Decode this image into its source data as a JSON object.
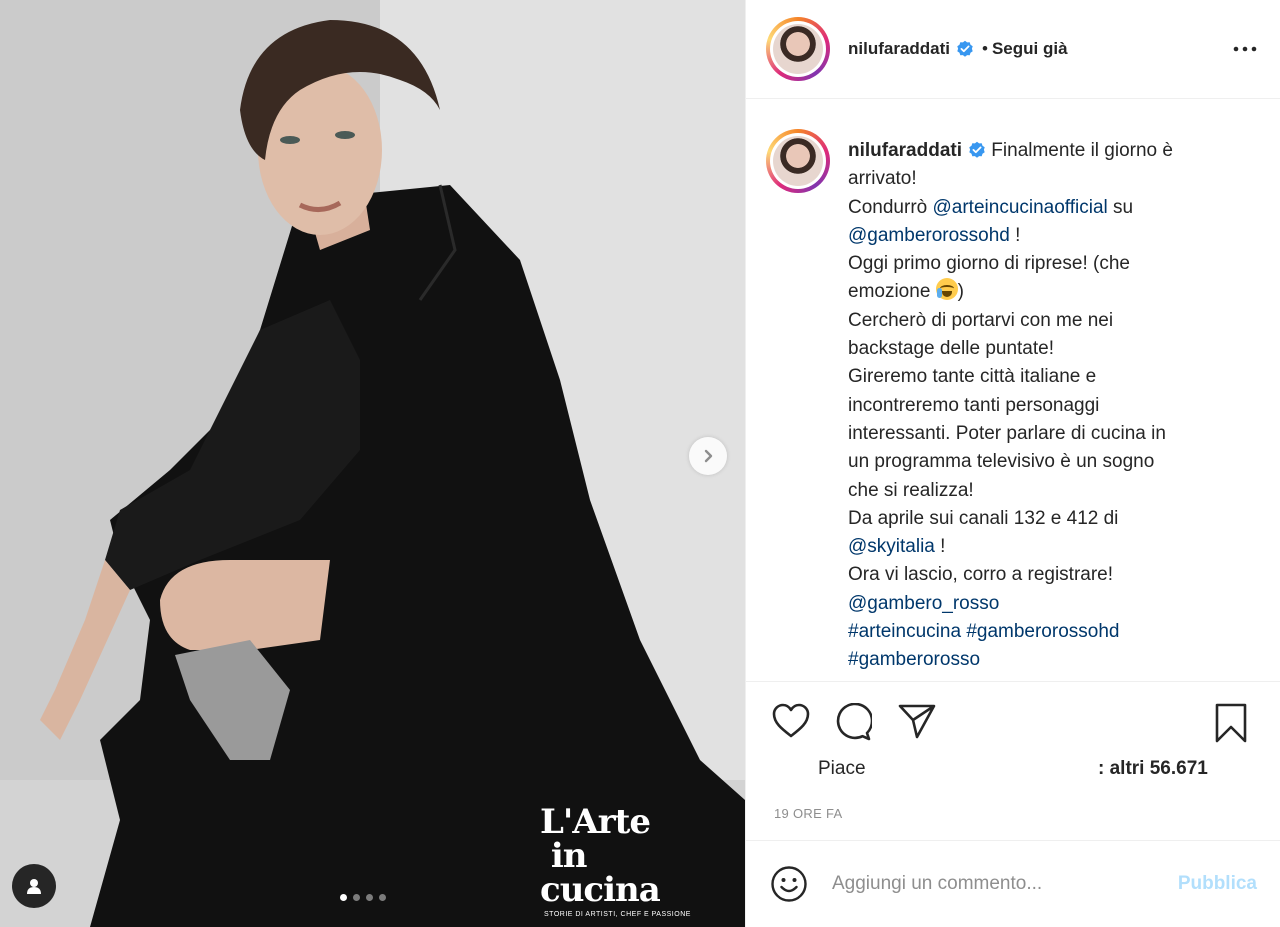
{
  "post": {
    "username": "nilufaraddati",
    "follow_separator": "•",
    "follow_label": "Segui già"
  },
  "media": {
    "watermark_title": "L'Arte in cucina",
    "watermark_subtitle": "STORIE DI ARTISTI, CHEF E PASSIONE",
    "slide_count": 4,
    "active_slide": 1
  },
  "caption": {
    "username": "nilufaraddati",
    "lines": [
      {
        "segments": [
          {
            "text": "Finalmente il giorno è"
          }
        ]
      },
      {
        "segments": [
          {
            "text": "arrivato!"
          }
        ]
      },
      {
        "segments": [
          {
            "text": "Condurrò "
          },
          {
            "text": "@arteincucinaofficial",
            "link": true
          },
          {
            "text": " su"
          }
        ]
      },
      {
        "segments": [
          {
            "text": "@gamberorossohd",
            "link": true
          },
          {
            "text": " !"
          }
        ]
      },
      {
        "segments": [
          {
            "text": "Oggi primo giorno di riprese! (che"
          }
        ]
      },
      {
        "segments": [
          {
            "text": "emozione "
          },
          {
            "emoji": "crying-face"
          },
          {
            "text": ")"
          }
        ]
      },
      {
        "segments": [
          {
            "text": "Cercherò di portarvi con me nei"
          }
        ]
      },
      {
        "segments": [
          {
            "text": "backstage delle puntate!"
          }
        ]
      },
      {
        "segments": [
          {
            "text": "Gireremo tante città italiane e"
          }
        ]
      },
      {
        "segments": [
          {
            "text": "incontreremo tanti personaggi"
          }
        ]
      },
      {
        "segments": [
          {
            "text": "interessanti. Poter parlare di cucina in"
          }
        ]
      },
      {
        "segments": [
          {
            "text": "un programma televisivo è un sogno"
          }
        ]
      },
      {
        "segments": [
          {
            "text": "che si realizza!"
          }
        ]
      },
      {
        "segments": [
          {
            "text": "Da aprile sui canali 132 e 412 di"
          }
        ]
      },
      {
        "segments": [
          {
            "text": "@skyitalia",
            "link": true
          },
          {
            "text": " !"
          }
        ]
      },
      {
        "segments": [
          {
            "text": "Ora vi lascio, corro a registrare!"
          }
        ]
      },
      {
        "segments": [
          {
            "text": "@gambero_rosso",
            "link": true
          }
        ]
      },
      {
        "segments": [
          {
            "text": "#arteincucina",
            "link": true
          },
          {
            "text": " "
          },
          {
            "text": "#gamberorossohd",
            "link": true
          }
        ]
      },
      {
        "segments": [
          {
            "text": "#gamberorosso",
            "link": true
          }
        ]
      }
    ]
  },
  "likes": {
    "prefix_fragment": "Piace",
    "others_fragment": ": altri 56.671"
  },
  "timestamp": "19 ORE FA",
  "comment": {
    "placeholder": "Aggiungi un commento...",
    "publish_label": "Pubblica"
  },
  "colors": {
    "link": "#00376b",
    "verified": "#3897f0",
    "publish_disabled": "#b2dffc",
    "muted": "#8e8e8e"
  },
  "icons": [
    "heart-icon",
    "comment-icon",
    "share-icon",
    "bookmark-icon",
    "emoji-icon",
    "more-icon",
    "verified-icon",
    "chevron-right-icon",
    "user-tag-icon"
  ]
}
